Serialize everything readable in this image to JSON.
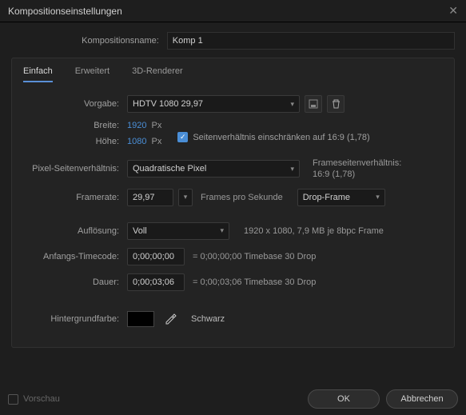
{
  "titlebar": {
    "title": "Kompositionseinstellungen"
  },
  "comp_name": {
    "label": "Kompositionsname:",
    "value": "Komp 1"
  },
  "tabs": {
    "basic": "Einfach",
    "advanced": "Erweitert",
    "renderer": "3D-Renderer"
  },
  "preset": {
    "label": "Vorgabe:",
    "value": "HDTV 1080 29,97"
  },
  "width": {
    "label": "Breite:",
    "value": "1920",
    "unit": "Px"
  },
  "height": {
    "label": "Höhe:",
    "value": "1080",
    "unit": "Px"
  },
  "lock_aspect": {
    "label": "Seitenverhältnis einschränken auf 16:9 (1,78)"
  },
  "par": {
    "label": "Pixel-Seitenverhältnis:",
    "value": "Quadratische Pixel"
  },
  "frame_aspect": {
    "line1": "Frameseitenverhältnis:",
    "line2": "16:9 (1,78)"
  },
  "framerate": {
    "label": "Framerate:",
    "value": "29,97",
    "fps": "Frames pro Sekunde",
    "drop": "Drop-Frame"
  },
  "resolution": {
    "label": "Auflösung:",
    "value": "Voll",
    "info": "1920 x 1080, 7,9 MB je 8bpc Frame"
  },
  "start_tc": {
    "label": "Anfangs-Timecode:",
    "value": "0;00;00;00",
    "info": "= 0;00;00;00  Timebase 30   Drop"
  },
  "duration": {
    "label": "Dauer:",
    "value": "0;00;03;06",
    "info": "= 0;00;03;06  Timebase 30   Drop"
  },
  "bgcolor": {
    "label": "Hintergrundfarbe:",
    "name": "Schwarz",
    "hex": "#000000"
  },
  "footer": {
    "preview": "Vorschau",
    "ok": "OK",
    "cancel": "Abbrechen"
  }
}
